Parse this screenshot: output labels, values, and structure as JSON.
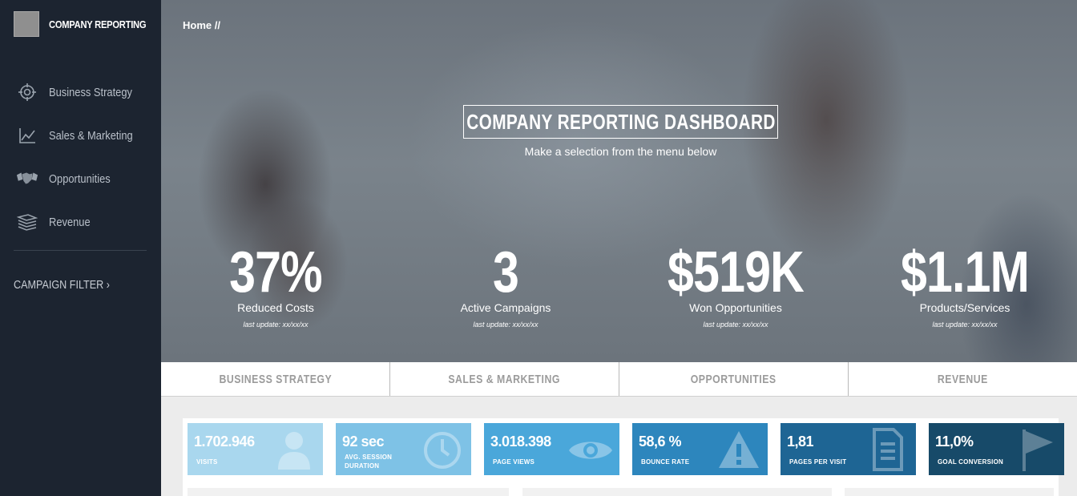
{
  "sidebar": {
    "brand_title": "COMPANY REPORTING",
    "items": [
      {
        "label": "Business Strategy",
        "icon": "crosshair-icon"
      },
      {
        "label": "Sales & Marketing",
        "icon": "line-chart-icon"
      },
      {
        "label": "Opportunities",
        "icon": "handshake-icon"
      },
      {
        "label": "Revenue",
        "icon": "money-stack-icon"
      }
    ],
    "campaign_filter": "CAMPAIGN FILTER ›"
  },
  "breadcrumb": "Home //",
  "hero": {
    "title": "COMPANY REPORTING DASHBOARD",
    "subtitle": "Make a selection from the menu below"
  },
  "kpis": [
    {
      "value": "37%",
      "label": "Reduced Costs",
      "update": "last update: xx/xx/xx"
    },
    {
      "value": "3",
      "label": "Active Campaigns",
      "update": "last update: xx/xx/xx"
    },
    {
      "value": "$519K",
      "label": "Won Opportunities",
      "update": "last update: xx/xx/xx"
    },
    {
      "value": "$1.1M",
      "label": "Products/Services",
      "update": "last update: xx/xx/xx"
    }
  ],
  "tabs": [
    "BUSINESS STRATEGY",
    "SALES & MARKETING",
    "OPPORTUNITIES",
    "REVENUE"
  ],
  "tiles": [
    {
      "value": "1.702.946",
      "label": "VISITS",
      "label2": "",
      "icon": "user-icon",
      "color": "#a9d7ee"
    },
    {
      "value": "92 sec",
      "label": "AVG. SESSION",
      "label2": "DURATION",
      "icon": "clock-icon",
      "color": "#7ec2e6"
    },
    {
      "value": "3.018.398",
      "label": "PAGE VIEWS",
      "label2": "",
      "icon": "eye-icon",
      "color": "#4aa7da"
    },
    {
      "value": "58,6 %",
      "label": "BOUNCE RATE",
      "label2": "",
      "icon": "warning-icon",
      "color": "#2d86bd"
    },
    {
      "value": "1,81",
      "label": "PAGES PER VISIT",
      "label2": "",
      "icon": "document-icon",
      "color": "#1e6594"
    },
    {
      "value": "11,0%",
      "label": "GOAL CONVERSION",
      "label2": "",
      "icon": "flag-icon",
      "color": "#174a69"
    }
  ]
}
